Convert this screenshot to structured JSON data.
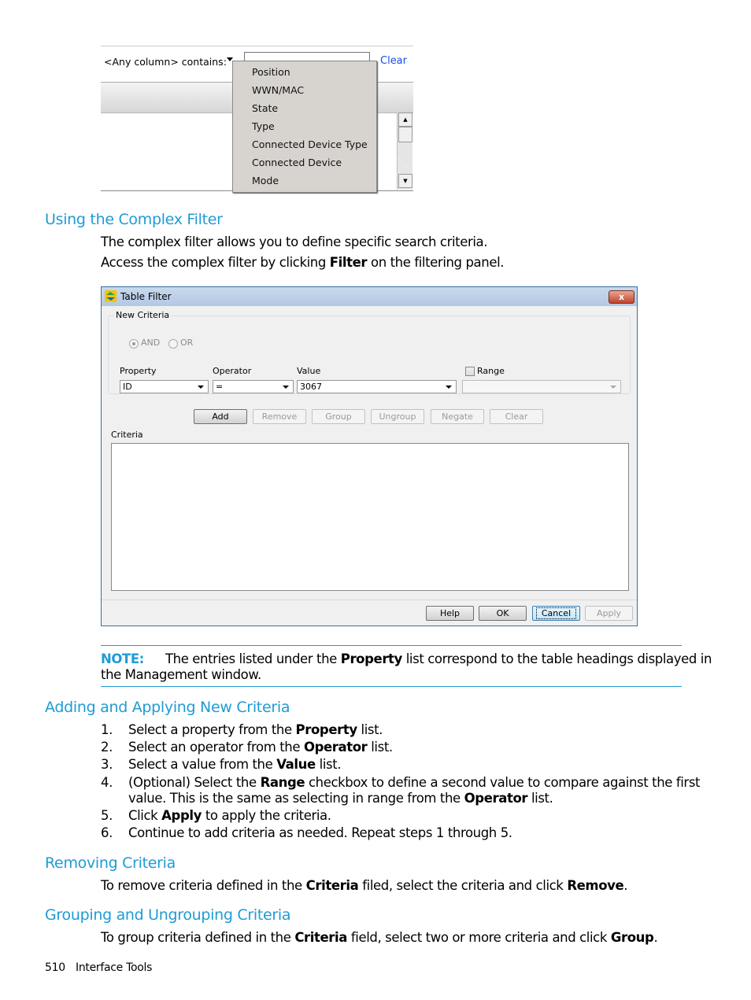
{
  "screenshot1": {
    "filter_label": "<Any column> contains:",
    "clear_link": "Clear",
    "dropdown_items": [
      "Position",
      "WWN/MAC",
      "State",
      "Type",
      "Connected Device Type",
      "Connected Device",
      "Mode"
    ]
  },
  "section_complex": {
    "heading": "Using the Complex Filter",
    "para1": "The complex filter allows you to define specific search criteria.",
    "para2_pre": "Access the complex filter by clicking ",
    "para2_bold": "Filter",
    "para2_post": " on the filtering panel."
  },
  "dialog": {
    "title": "Table Filter",
    "close_label": "x",
    "new_criteria_label": "New Criteria",
    "and_label": "AND",
    "or_label": "OR",
    "property_label": "Property",
    "property_value": "ID",
    "operator_label": "Operator",
    "operator_value": "=",
    "value_label": "Value",
    "value_value": "3067",
    "range_label": "Range",
    "buttons": [
      "Add",
      "Remove",
      "Group",
      "Ungroup",
      "Negate",
      "Clear"
    ],
    "criteria_label": "Criteria",
    "footer_buttons": [
      "Help",
      "OK",
      "Cancel",
      "Apply"
    ]
  },
  "note": {
    "label": "NOTE:",
    "text_pre": "The entries listed under the ",
    "text_bold": "Property",
    "text_post": " list correspond to the table headings displayed in",
    "line2": "the Management window."
  },
  "section_adding": {
    "heading": "Adding and Applying New Criteria",
    "steps": [
      {
        "n": "1.",
        "pre": "Select a property from the ",
        "bold": "Property",
        "post": " list."
      },
      {
        "n": "2.",
        "pre": "Select an operator from the ",
        "bold": "Operator",
        "post": " list."
      },
      {
        "n": "3.",
        "pre": "Select a value from the ",
        "bold": "Value",
        "post": " list."
      },
      {
        "n": "4.",
        "pre": "(Optional) Select the ",
        "bold": "Range",
        "post": " checkbox to define a second value to compare against the first",
        "line2_pre": "value. This is the same as selecting in range from the ",
        "line2_bold": "Operator",
        "line2_post": " list."
      },
      {
        "n": "5.",
        "pre": "Click ",
        "bold": "Apply",
        "post": " to apply the criteria."
      },
      {
        "n": "6.",
        "pre": "Continue to add criteria as needed. Repeat steps 1 through 5.",
        "bold": "",
        "post": ""
      }
    ]
  },
  "section_removing": {
    "heading": "Removing Criteria",
    "pre": "To remove criteria defined in the ",
    "bold1": "Criteria",
    "mid": " filed, select the criteria and click ",
    "bold2": "Remove",
    "post": "."
  },
  "section_grouping": {
    "heading": "Grouping and Ungrouping Criteria",
    "pre": "To group criteria defined in the ",
    "bold1": "Criteria",
    "mid": " field, select two or more criteria and click ",
    "bold2": "Group",
    "post": "."
  },
  "footer": {
    "page_number": "510",
    "section": "Interface Tools"
  }
}
